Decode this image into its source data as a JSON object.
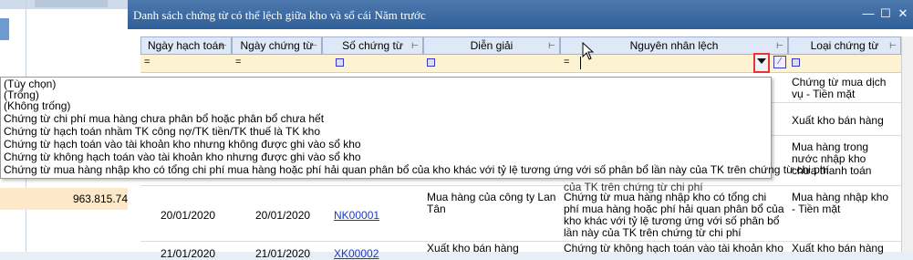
{
  "background": {
    "amount": "963.815.74"
  },
  "window": {
    "title": "Danh sách chứng từ có thể lệch giữa kho và sổ cái Năm trước"
  },
  "columns": [
    {
      "label": "Ngày hạch toán"
    },
    {
      "label": "Ngày chứng từ"
    },
    {
      "label": "Số chứng từ"
    },
    {
      "label": "Diễn giải"
    },
    {
      "label": "Nguyên nhân lệch"
    },
    {
      "label": "Loại chứng từ"
    }
  ],
  "filter": {
    "eq": "="
  },
  "rows": [
    {
      "loai": "Chứng từ mua dịch vụ  - Tiền mặt"
    },
    {
      "loai": "Xuất kho bán hàng"
    },
    {
      "loai": "Mua hàng trong nước nhập kho chưa thanh toán"
    },
    {
      "ngay_ht": "20/01/2020",
      "ngay_ct": "20/01/2020",
      "so_ct": "NK00001",
      "dien_giai": "Mua hàng của công ty Lan Tân",
      "nguyen_nhan": "Chứng từ mua hàng nhập kho có tổng chi phí mua hàng hoặc phí hải quan phân bổ của kho khác với tỷ lệ tương ứng với số phân bổ lần này của TK trên chứng từ chi phí",
      "loai": "Mua hàng nhập kho - Tiền mặt"
    },
    {
      "ngay_ht": "21/01/2020",
      "ngay_ct": "21/01/2020",
      "so_ct": "XK00002",
      "dien_giai": "Xuất kho bán hàng",
      "nguyen_nhan": "Chứng từ không hạch toán vào tài khoản kho",
      "loai": "Xuất kho bán hàng"
    }
  ],
  "prev_row_tail": "của TK trên chứng từ chi phí",
  "dropdown_options": [
    "(Tùy chọn)",
    "(Trống)",
    "(Không trống)",
    "Chứng từ chi phí mua hàng chưa phân bổ hoặc phân bổ chưa hết",
    "Chứng từ hạch toán nhầm TK công nợ/TK tiền/TK thuế là TK kho",
    "Chứng từ hạch toán vào tài khoản kho nhưng không được ghi vào sổ kho",
    "Chứng từ không hạch toán vào tài khoản kho nhưng được ghi vào sổ kho",
    "Chứng từ mua hàng nhập kho có tổng chi phí mua hàng hoặc phí hải quan phân bổ của kho khác với tỷ lệ tương ứng với số phân bổ lần này của TK trên chứng từ chi phí"
  ]
}
